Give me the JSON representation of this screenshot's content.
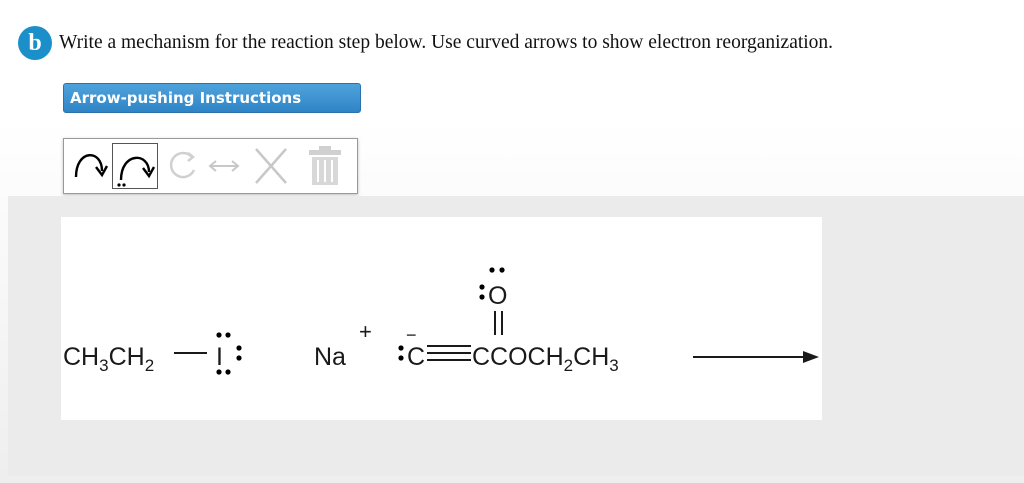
{
  "question": {
    "badge": "b",
    "text": "Write a mechanism for the reaction step below. Use curved arrows to show electron reorganization."
  },
  "instructions_button": {
    "label": "Arrow-pushing Instructions"
  },
  "toolbar": {
    "tools": [
      {
        "name": "curved-arrow-icon"
      },
      {
        "name": "curved-arrow-lone-pair-icon"
      },
      {
        "name": "circular-arrow-icon"
      },
      {
        "name": "double-arrow-icon"
      },
      {
        "name": "close-icon"
      },
      {
        "name": "trash-icon"
      }
    ]
  },
  "scheme": {
    "ethyl_a": "CH",
    "sub_3": "3",
    "ethyl_b": "CH",
    "sub_2": "2",
    "iodine": "I",
    "sodium": "Na",
    "plus": "+",
    "minus": "−",
    "carbanion": "C",
    "ester_tail_a": "CCOCH",
    "ester_tail_sub2": "2",
    "ester_tail_b": "CH",
    "ester_tail_sub3": "3",
    "oxygen": "O"
  }
}
